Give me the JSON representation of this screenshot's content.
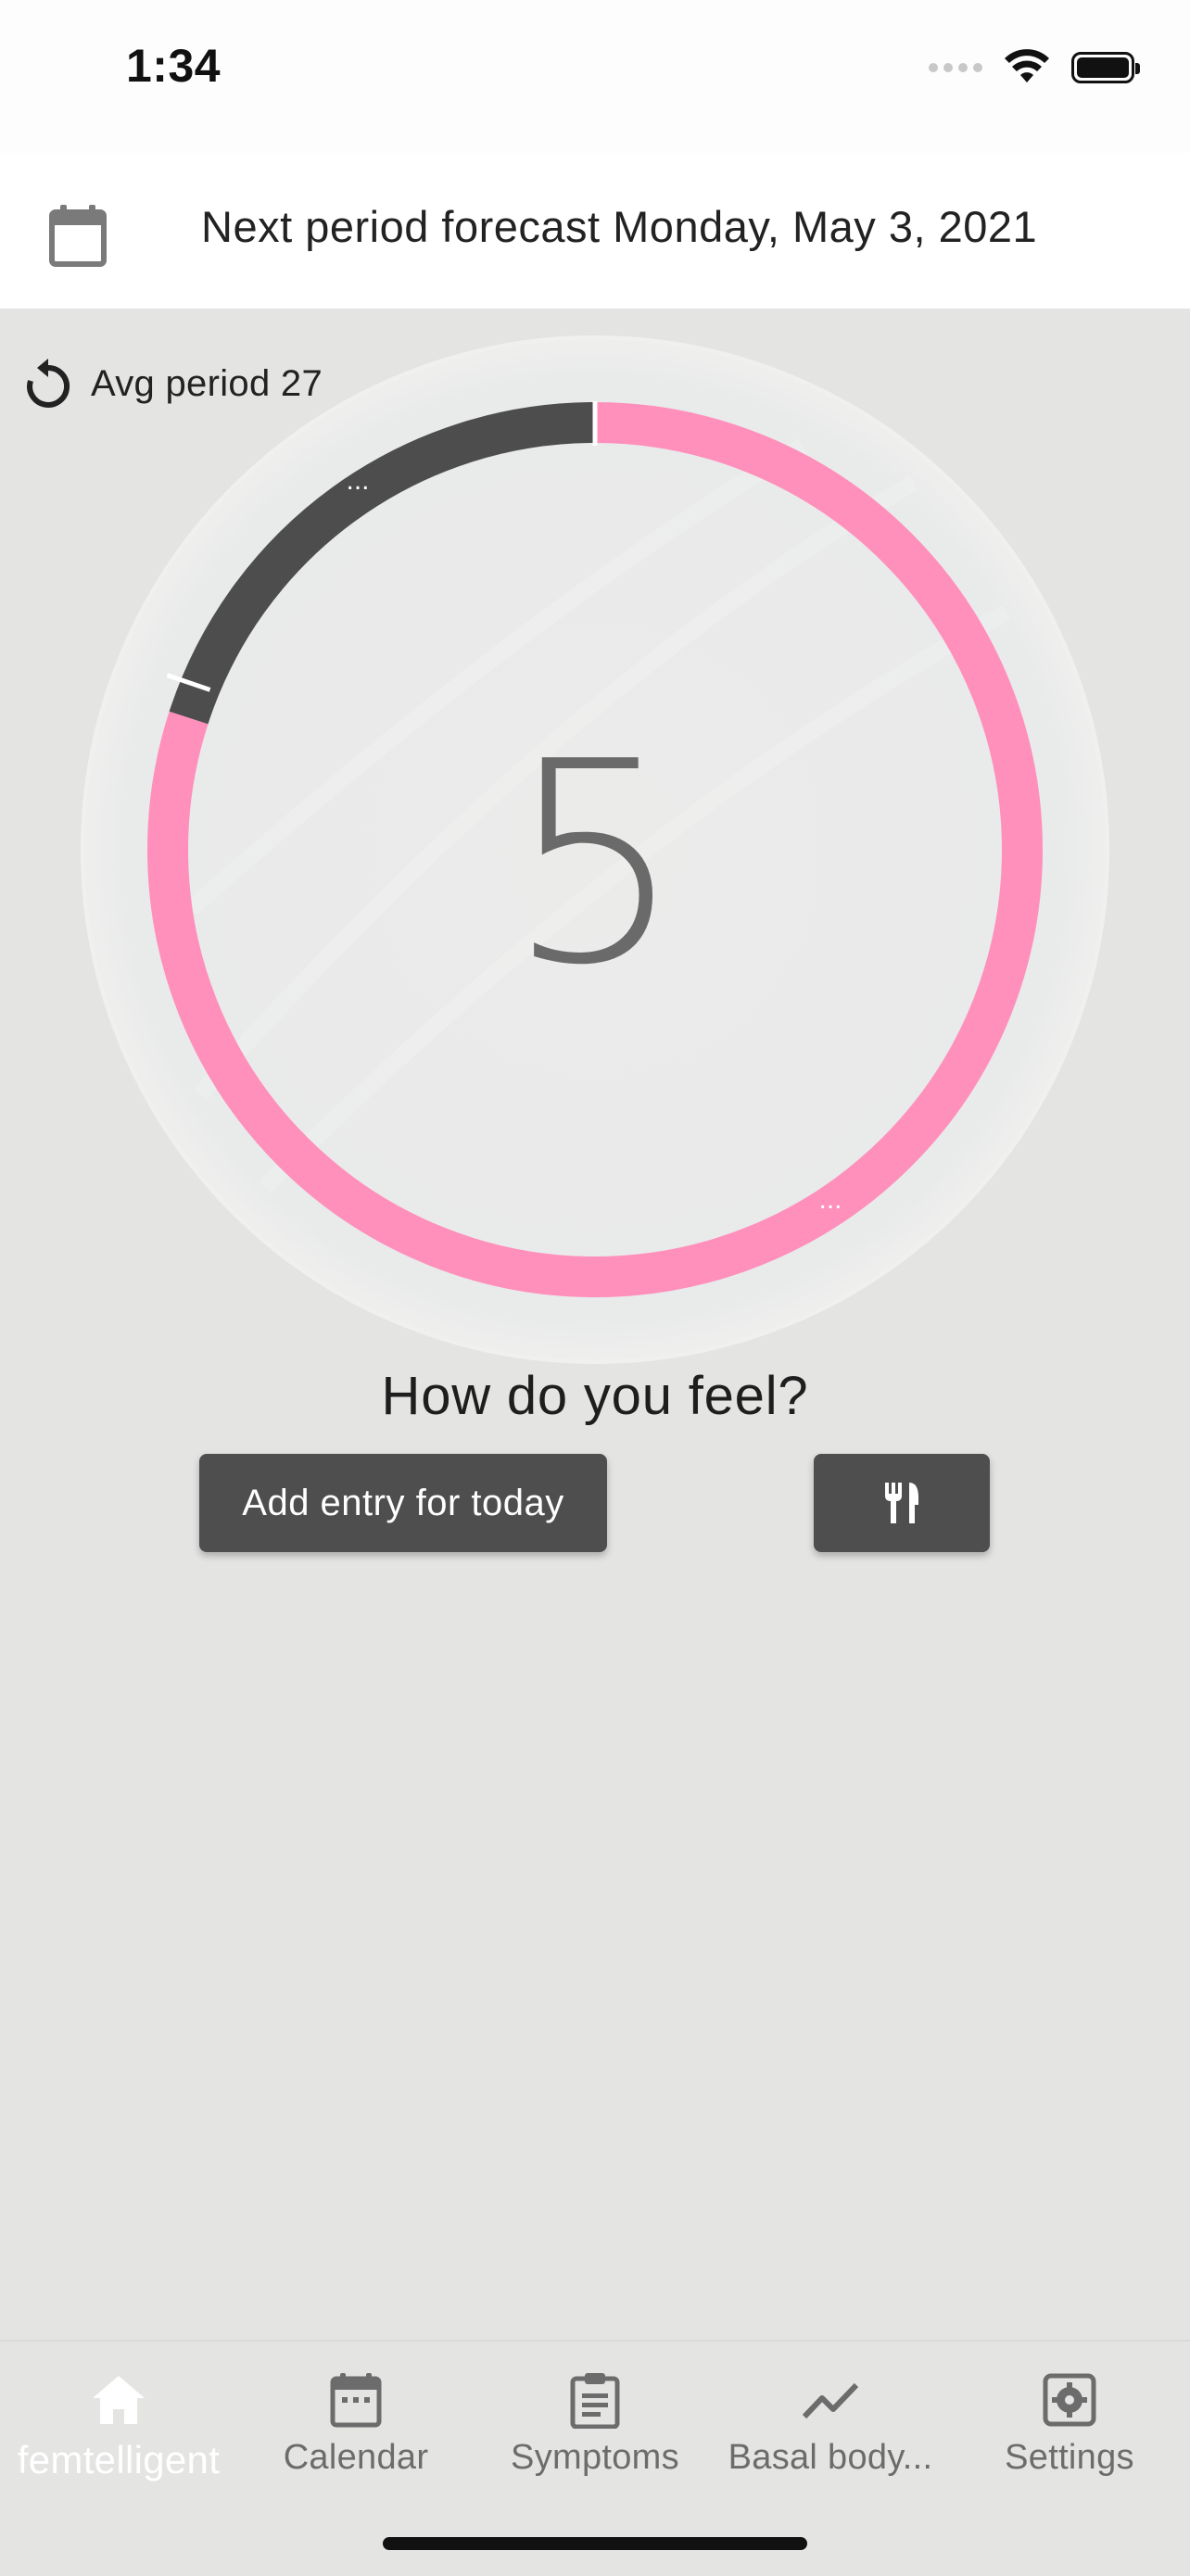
{
  "status_bar": {
    "time": "1:34"
  },
  "header": {
    "forecast": "Next period forecast Monday, May 3, 2021"
  },
  "cycle": {
    "avg_period_label": "Avg period 27",
    "current_day": "5",
    "ring_colors": {
      "period": "#4d4d4d",
      "cycle": "#ff8fbb"
    },
    "marker_glyph": "..."
  },
  "prompt": {
    "title": "How do you feel?",
    "add_entry_label": "Add entry for today"
  },
  "nav": {
    "items": [
      {
        "label": "femtelligent",
        "icon": "home-icon"
      },
      {
        "label": "Calendar",
        "icon": "calendar-icon"
      },
      {
        "label": "Symptoms",
        "icon": "clipboard-icon"
      },
      {
        "label": "Basal body...",
        "icon": "trend-icon"
      },
      {
        "label": "Settings",
        "icon": "gear-icon"
      }
    ]
  },
  "colors": {
    "accent_pink": "#ff8fbb",
    "dark_button": "#4e4e4e",
    "background": "#e4e4e3"
  }
}
